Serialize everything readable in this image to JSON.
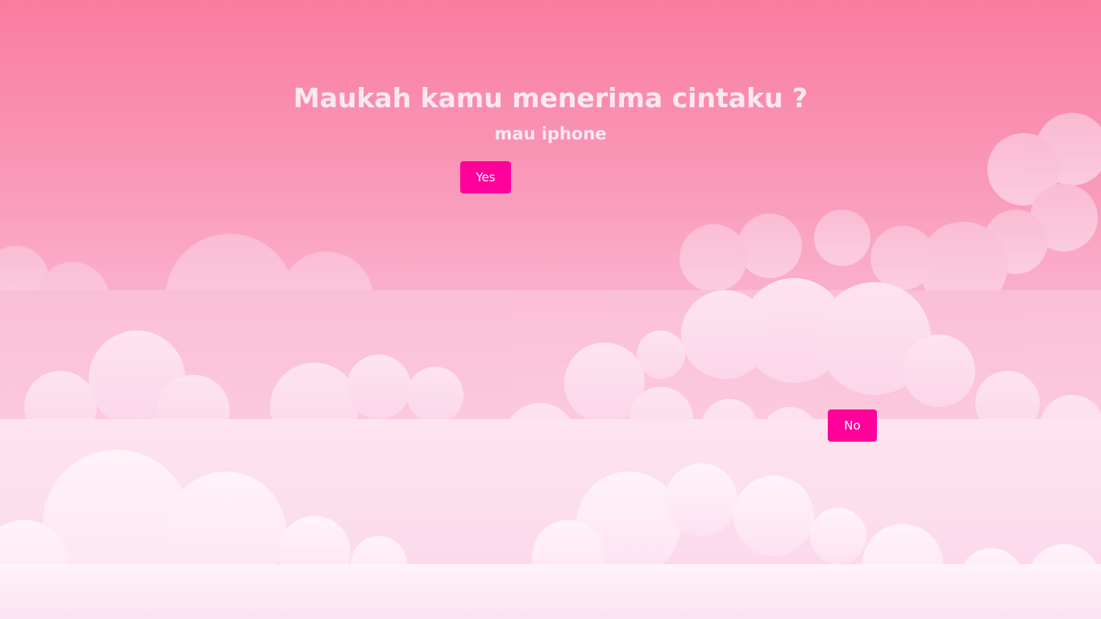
{
  "question": {
    "title": "Maukah kamu menerima cintaku ?",
    "subtitle": "mau iphone"
  },
  "buttons": {
    "yes_label": "Yes",
    "no_label": "No"
  },
  "colors": {
    "background_top": "#f97ca0",
    "background_bottom": "#fde8fb",
    "button": "#ff009b",
    "button_text": "#ffffff",
    "heading_text": "#fde8f1"
  }
}
